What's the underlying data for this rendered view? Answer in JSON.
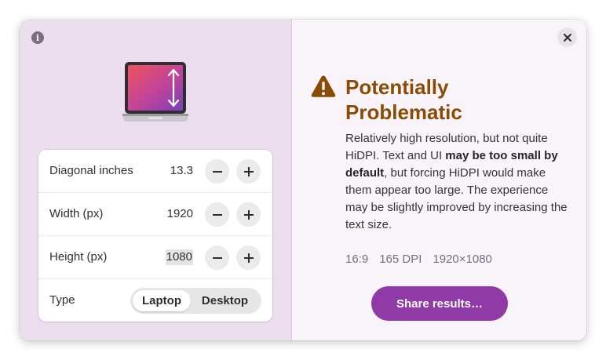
{
  "left_panel": {
    "rows": [
      {
        "label": "Diagonal inches",
        "value": "13.3"
      },
      {
        "label": "Width (px)",
        "value": "1920"
      },
      {
        "label": "Height (px)",
        "value": "1080"
      }
    ],
    "type_row": {
      "label": "Type",
      "options": [
        "Laptop",
        "Desktop"
      ],
      "selected": "Laptop"
    },
    "icons": {
      "info": "info-icon",
      "device": "laptop-icon",
      "decrement": "minus-icon",
      "increment": "plus-icon"
    }
  },
  "right_panel": {
    "title": "Potentially Problematic",
    "description": {
      "part1": "Relatively high resolution, but not quite HiDPI. Text and UI ",
      "emphasis": "may be too small by default",
      "part2": ", but forcing HiDPI would make them appear too large. The experience may be slightly improved by increasing the text size."
    },
    "meta": {
      "aspect_ratio": "16:9",
      "dpi": "165 DPI",
      "resolution": "1920×1080"
    },
    "share_label": "Share results…",
    "icons": {
      "close": "close-icon",
      "warning": "warning-icon"
    }
  },
  "colors": {
    "left_bg": "#ecdeef",
    "right_bg": "#f9f4fa",
    "warning": "#8a4c05",
    "accent": "#8f3aa6"
  }
}
